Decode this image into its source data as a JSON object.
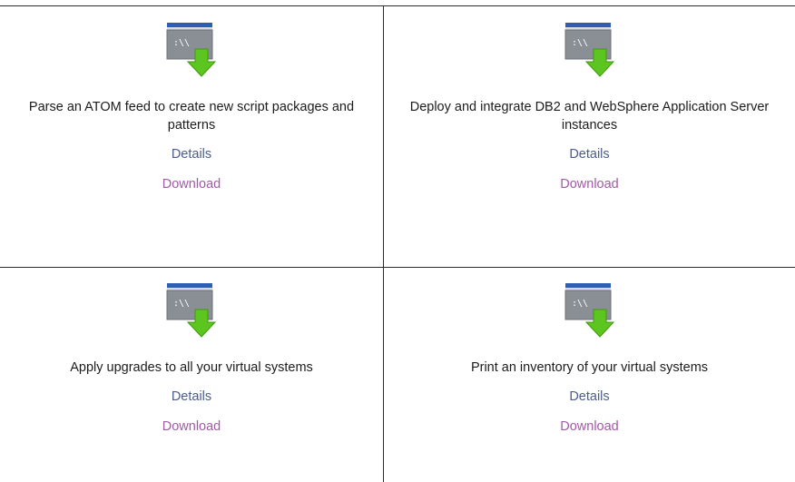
{
  "icon": "script-download-icon",
  "colors": {
    "details_link": "#4a5d8e",
    "download_link": "#a25aa8",
    "grid_line": "#2b2b2b",
    "icon_window_bar": "#2f5fb3",
    "icon_window_body": "#8a8f96",
    "icon_arrow": "#5cc51f"
  },
  "cards": [
    {
      "title": "Parse an ATOM feed to create new script packages and patterns",
      "details_label": "Details",
      "download_label": "Download",
      "icon_text": ":\\\\"
    },
    {
      "title": "Deploy and integrate DB2 and WebSphere Application Server instances",
      "details_label": "Details",
      "download_label": "Download",
      "icon_text": ":\\\\"
    },
    {
      "title": "Apply upgrades to all your virtual systems",
      "details_label": "Details",
      "download_label": "Download",
      "icon_text": ":\\\\"
    },
    {
      "title": "Print an inventory of your virtual systems",
      "details_label": "Details",
      "download_label": "Download",
      "icon_text": ":\\\\"
    }
  ]
}
